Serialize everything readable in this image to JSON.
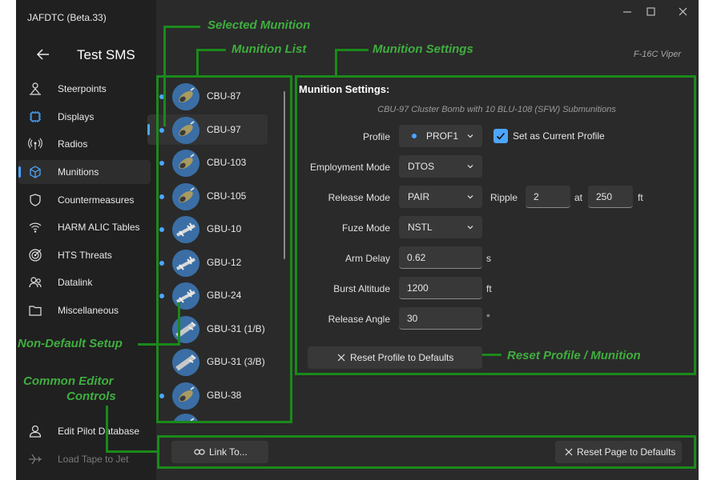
{
  "window": {
    "app_title": "JAFDTC (Beta.33)",
    "page_title": "Test SMS",
    "airframe": "F-16C Viper"
  },
  "nav": {
    "items": [
      {
        "label": "Steerpoints",
        "icon": "person-pin-icon"
      },
      {
        "label": "Displays",
        "icon": "chip-icon"
      },
      {
        "label": "Radios",
        "icon": "antenna-icon"
      },
      {
        "label": "Munitions",
        "icon": "cube-icon"
      },
      {
        "label": "Countermeasures",
        "icon": "shield-icon"
      },
      {
        "label": "HARM ALIC Tables",
        "icon": "wifi-icon"
      },
      {
        "label": "HTS Threats",
        "icon": "target-icon"
      },
      {
        "label": "Datalink",
        "icon": "people-icon"
      },
      {
        "label": "Miscellaneous",
        "icon": "folder-icon"
      }
    ],
    "footer": [
      {
        "label": "Edit Pilot Database",
        "icon": "person-icon"
      },
      {
        "label": "Load Tape to Jet",
        "icon": "jet-icon"
      }
    ]
  },
  "munitions": {
    "items": [
      {
        "label": "CBU-87",
        "modified": true,
        "kind": "bomb"
      },
      {
        "label": "CBU-97",
        "modified": true,
        "kind": "bomb",
        "selected": true
      },
      {
        "label": "CBU-103",
        "modified": true,
        "kind": "bomb"
      },
      {
        "label": "CBU-105",
        "modified": true,
        "kind": "bomb"
      },
      {
        "label": "GBU-10",
        "modified": true,
        "kind": "guided"
      },
      {
        "label": "GBU-12",
        "modified": true,
        "kind": "guided"
      },
      {
        "label": "GBU-24",
        "modified": true,
        "kind": "guided"
      },
      {
        "label": "GBU-31 (1/B)",
        "modified": false,
        "kind": "jdam"
      },
      {
        "label": "GBU-31 (3/B)",
        "modified": false,
        "kind": "jdam"
      },
      {
        "label": "GBU-38",
        "modified": true,
        "kind": "bomb"
      }
    ]
  },
  "settings": {
    "title": "Munition Settings:",
    "subtitle": "CBU-97 Cluster Bomb with 10 BLU-108 (SFW) Submunitions",
    "profile_label": "Profile",
    "profile_value": "PROF1",
    "set_current_label": "Set as Current Profile",
    "set_current_checked": true,
    "employment_label": "Employment Mode",
    "employment_value": "DTOS",
    "release_label": "Release Mode",
    "release_value": "PAIR",
    "ripple_label": "Ripple",
    "ripple_value": "2",
    "at_label": "at",
    "ripple_spacing": "250",
    "ripple_unit": "ft",
    "fuze_label": "Fuze Mode",
    "fuze_value": "NSTL",
    "arm_delay_label": "Arm Delay",
    "arm_delay_value": "0.62",
    "arm_delay_unit": "s",
    "burst_label": "Burst Altitude",
    "burst_value": "1200",
    "burst_unit": "ft",
    "angle_label": "Release Angle",
    "angle_value": "30",
    "angle_unit": "°",
    "reset_profile_label": "Reset Profile to Defaults"
  },
  "footer": {
    "link_label": "Link To...",
    "reset_page_label": "Reset Page to Defaults"
  },
  "callouts": {
    "selected_munition": "Selected Munition",
    "munition_list": "Munition List",
    "munition_settings": "Munition Settings",
    "non_default": "Non-Default Setup",
    "common_editor_1": "Common Editor",
    "common_editor_2": "Controls",
    "reset_profile": "Reset Profile / Munition"
  },
  "colors": {
    "accent": "#4ca6ff",
    "callout_green": "#3fae3f",
    "frame_green": "#1a8a1a"
  }
}
